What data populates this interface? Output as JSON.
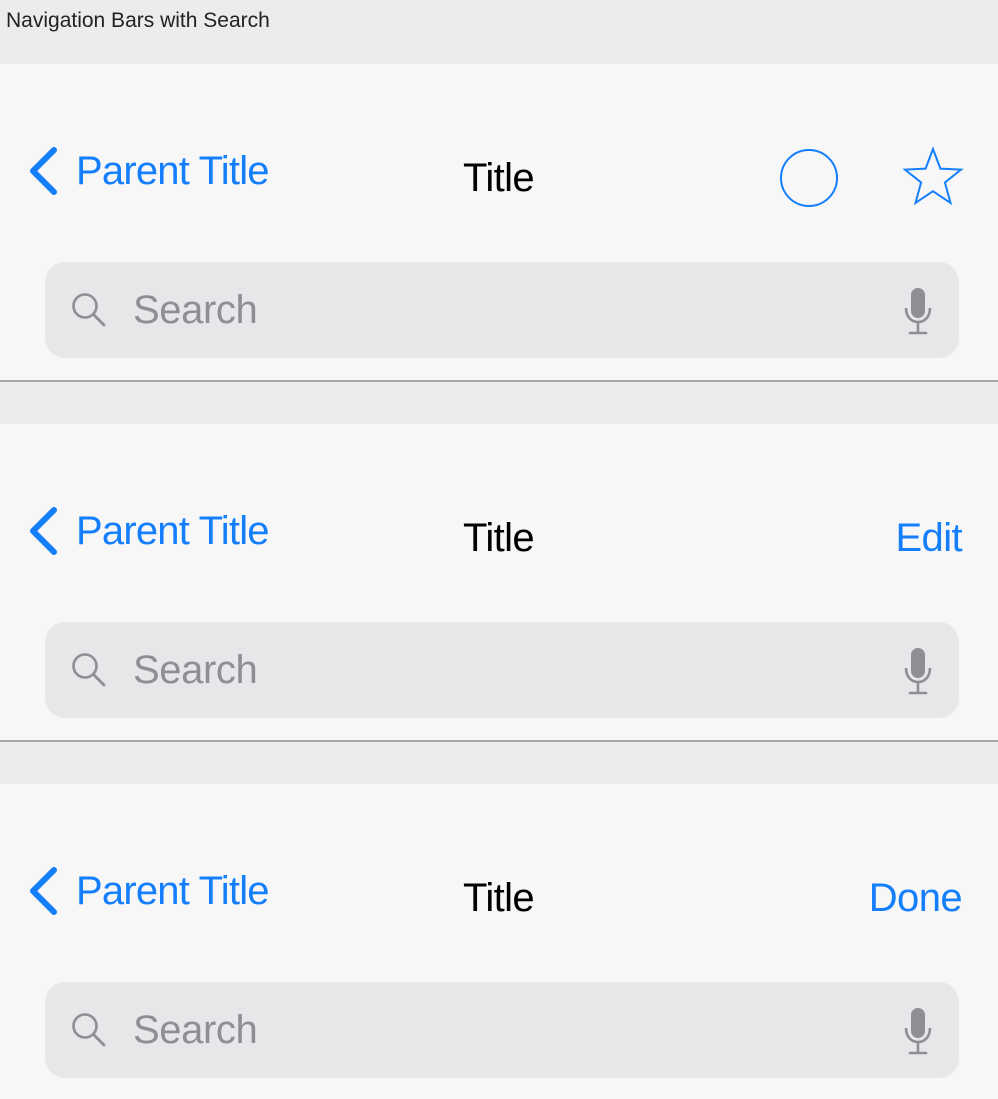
{
  "page": {
    "header": "Navigation Bars with Search"
  },
  "colors": {
    "accent": "#147efb",
    "bar_background": "#f7f7f7",
    "search_background": "#e6e7e9",
    "placeholder": "#8e8e93"
  },
  "navbars": [
    {
      "back_label": "Parent Title",
      "title": "Title",
      "right_icons": [
        "circle-icon",
        "star-icon"
      ],
      "search_placeholder": "Search"
    },
    {
      "back_label": "Parent Title",
      "title": "Title",
      "right_button": "Edit",
      "search_placeholder": "Search"
    },
    {
      "back_label": "Parent Title",
      "title": "Title",
      "right_button": "Done",
      "search_placeholder": "Search"
    }
  ]
}
